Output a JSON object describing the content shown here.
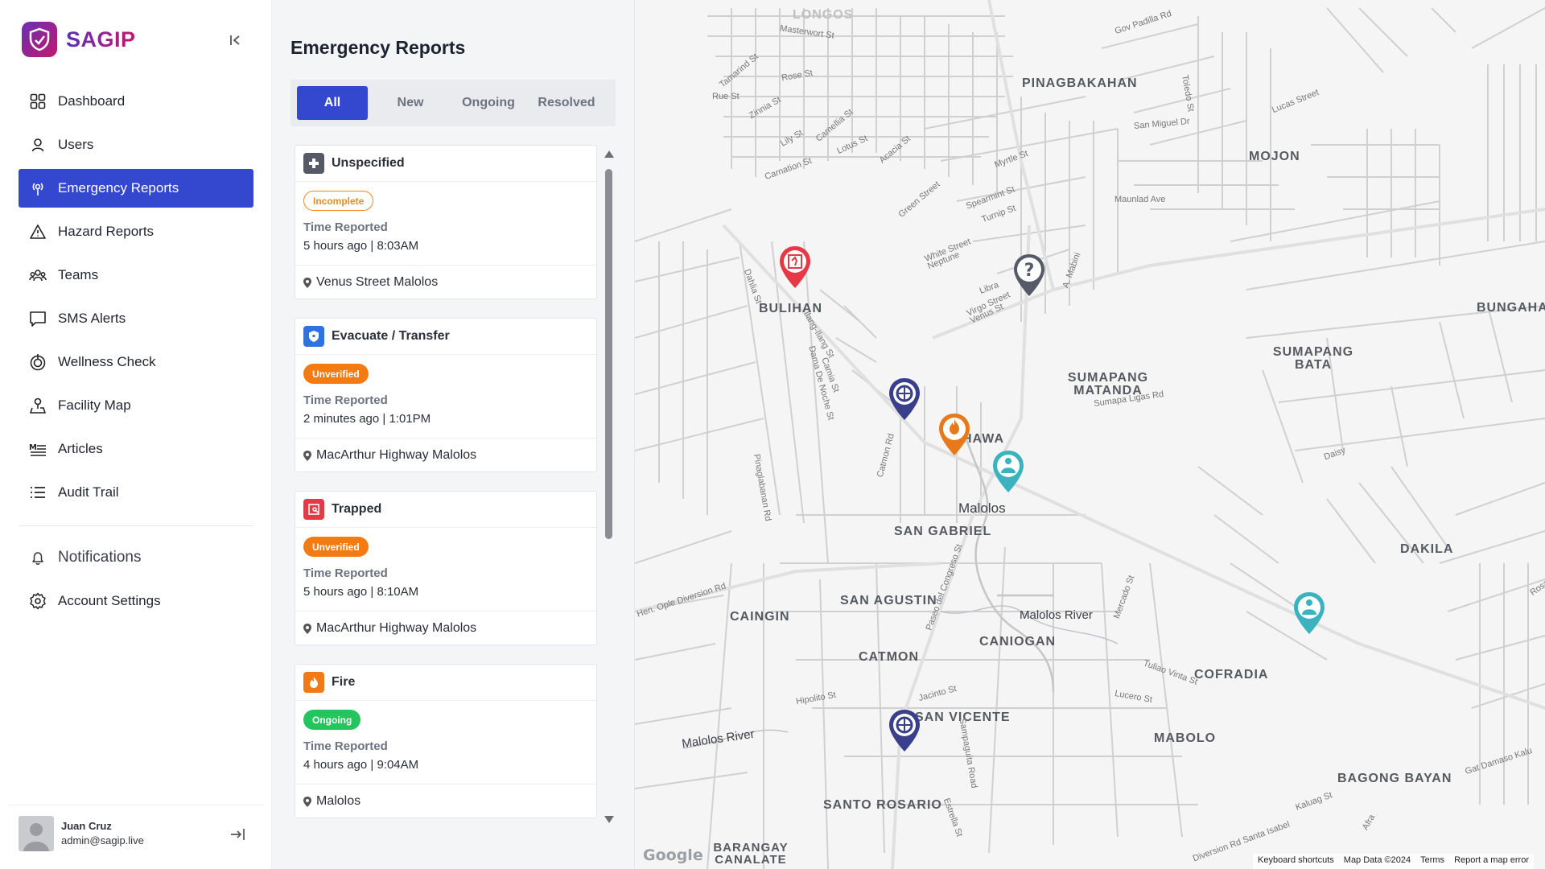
{
  "brand": {
    "name": "SAGIP"
  },
  "nav": {
    "items": [
      {
        "label": "Dashboard",
        "icon": "grid-icon"
      },
      {
        "label": "Users",
        "icon": "user-icon"
      },
      {
        "label": "Emergency Reports",
        "icon": "signal-icon",
        "active": true
      },
      {
        "label": "Hazard Reports",
        "icon": "warning-icon"
      },
      {
        "label": "Teams",
        "icon": "team-icon"
      },
      {
        "label": "SMS Alerts",
        "icon": "chat-icon"
      },
      {
        "label": "Wellness Check",
        "icon": "heart-pulse-icon"
      },
      {
        "label": "Facility Map",
        "icon": "map-pin-icon"
      },
      {
        "label": "Articles",
        "icon": "article-icon"
      },
      {
        "label": "Audit Trail",
        "icon": "list-icon"
      }
    ],
    "notifications": "Notifications",
    "account_settings": "Account Settings"
  },
  "user": {
    "name": "Juan Cruz",
    "email": "admin@sagip.live"
  },
  "panel": {
    "title": "Emergency Reports",
    "tabs": [
      "All",
      "New",
      "Ongoing",
      "Resolved"
    ],
    "active_tab": "All",
    "time_label": "Time Reported",
    "reports": [
      {
        "category": "Unspecified",
        "status": "Incomplete",
        "time": "5 hours ago | 8:03AM",
        "location": "Venus Street Malolos"
      },
      {
        "category": "Evacuate / Transfer",
        "status": "Unverified",
        "time": "2 minutes ago | 1:01PM",
        "location": "MacArthur Highway Malolos"
      },
      {
        "category": "Trapped",
        "status": "Unverified",
        "time": "5 hours ago | 8:10AM",
        "location": "MacArthur Highway Malolos"
      },
      {
        "category": "Fire",
        "status": "Ongoing",
        "time": "4 hours ago | 9:04AM",
        "location": "Malolos"
      }
    ]
  },
  "colors": {
    "primary": "#3347cf",
    "incomplete": "#f08a1c",
    "unverified": "#f37b12",
    "ongoing": "#22c55e",
    "trapped": "#e53946",
    "fire": "#f07a16",
    "unspecified": "#555a66",
    "evacuate": "#2f72e6",
    "medical": "#3ab3be",
    "rescue": "#3a3f8c"
  },
  "map": {
    "places": [
      "PINAGBAKAHAN",
      "MOJON",
      "BULIHAN",
      "SUMAPANG MATANDA",
      "SUMAPANG BATA",
      "BUNGAHAN",
      "SAN GABRIEL",
      "SAN AGUSTIN",
      "CAINGIN",
      "CATMON",
      "CANIOGAN",
      "COFRADIA",
      "DAKILA",
      "SAN VICENTE",
      "MABOLO",
      "BAGONG BAYAN",
      "SANTO ROSARIO",
      "BARANGAY CANALATE",
      "LONGOS",
      "PINHAWA"
    ],
    "city": "Malolos",
    "rivers": [
      "Malolos River",
      "Malolos River"
    ],
    "streets": [
      "Gov Padilla Rd",
      "Masterwort St",
      "Tamarind St",
      "Rose St",
      "Rue St",
      "Zinnia St",
      "Lily St",
      "Camellia St",
      "Lotus St",
      "Carnation St",
      "Acacia St",
      "Myrtle St",
      "Green Street",
      "Spearmint St",
      "Turnip St",
      "White Street Neptune",
      "Libra",
      "Virgo Street Venus St",
      "A. Mabini",
      "Dahlia St",
      "Ilang-Ilang St",
      "Dama De Noche St",
      "Camia St",
      "Sumapa Ligas Rd",
      "Lucas Street",
      "Toledo St",
      "San Miguel Dr",
      "Maunlad Ave",
      "Daisy",
      "Catmon Rd",
      "Paseo del Congreso St",
      "Jacinto St",
      "Hipolito St",
      "Mercado St",
      "Hen. Ople Diversion Rd",
      "Pinaglabanan Rd",
      "Sampaguita Road",
      "Kaluag St",
      "Gat Damaso Kalu",
      "Rosal St",
      "Diversion Rd Santa Isabel",
      "Tuliao Vinta St",
      "Lucero St",
      "Afra",
      "Estrella St"
    ],
    "markers": [
      "trapped-marker",
      "unspecified-marker",
      "rescue-marker",
      "fire-marker",
      "medical-marker",
      "medical-marker",
      "rescue-marker"
    ],
    "logo": "Google",
    "attribution": [
      "Keyboard shortcuts",
      "Map Data ©2024",
      "Terms",
      "Report a map error"
    ]
  }
}
